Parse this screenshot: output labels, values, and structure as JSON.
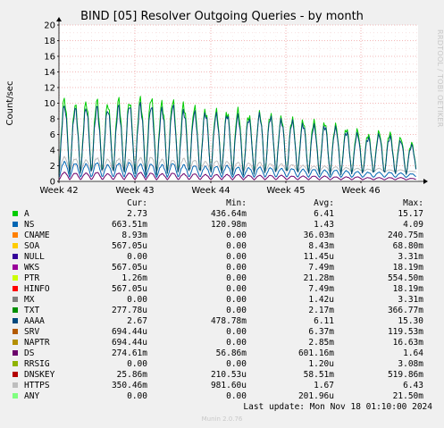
{
  "title": "BIND [05] Resolver Outgoing Queries - by month",
  "side_label": "RRDTOOL / TOBI OETIKER",
  "footer": {
    "last_update": "Last update: Mon Nov 18 01:10:00 2024",
    "generator": "Munin 2.0.76"
  },
  "legend_header": {
    "cur": "Cur:",
    "min": "Min:",
    "avg": "Avg:",
    "max": "Max:"
  },
  "legend": [
    {
      "name": "A",
      "color": "#00cc00",
      "cur": "2.73",
      "min": "436.64m",
      "avg": "6.41",
      "max": "15.17"
    },
    {
      "name": "NS",
      "color": "#0066b3",
      "cur": "663.51m",
      "min": "120.98m",
      "avg": "1.43",
      "max": "4.09"
    },
    {
      "name": "CNAME",
      "color": "#ff8000",
      "cur": "8.93m",
      "min": "0.00",
      "avg": "36.03m",
      "max": "240.75m"
    },
    {
      "name": "SOA",
      "color": "#ffcc00",
      "cur": "567.05u",
      "min": "0.00",
      "avg": "8.43m",
      "max": "68.80m"
    },
    {
      "name": "NULL",
      "color": "#330099",
      "cur": "0.00",
      "min": "0.00",
      "avg": "11.45u",
      "max": "3.31m"
    },
    {
      "name": "WKS",
      "color": "#990099",
      "cur": "567.05u",
      "min": "0.00",
      "avg": "7.49m",
      "max": "18.19m"
    },
    {
      "name": "PTR",
      "color": "#ccff00",
      "cur": "1.26m",
      "min": "0.00",
      "avg": "21.28m",
      "max": "554.50m"
    },
    {
      "name": "HINFO",
      "color": "#ff0000",
      "cur": "567.05u",
      "min": "0.00",
      "avg": "7.49m",
      "max": "18.19m"
    },
    {
      "name": "MX",
      "color": "#808080",
      "cur": "0.00",
      "min": "0.00",
      "avg": "1.42u",
      "max": "3.31m"
    },
    {
      "name": "TXT",
      "color": "#008f00",
      "cur": "277.78u",
      "min": "0.00",
      "avg": "2.17m",
      "max": "366.77m"
    },
    {
      "name": "AAAA",
      "color": "#00487d",
      "cur": "2.67",
      "min": "478.78m",
      "avg": "6.11",
      "max": "15.30"
    },
    {
      "name": "SRV",
      "color": "#b35a00",
      "cur": "694.44u",
      "min": "0.00",
      "avg": "6.37m",
      "max": "119.53m"
    },
    {
      "name": "NAPTR",
      "color": "#b38f00",
      "cur": "694.44u",
      "min": "0.00",
      "avg": "2.85m",
      "max": "16.63m"
    },
    {
      "name": "DS",
      "color": "#6b006b",
      "cur": "274.61m",
      "min": "56.86m",
      "avg": "601.16m",
      "max": "1.64"
    },
    {
      "name": "RRSIG",
      "color": "#8fb300",
      "cur": "0.00",
      "min": "0.00",
      "avg": "1.20u",
      "max": "3.08m"
    },
    {
      "name": "DNSKEY",
      "color": "#b30000",
      "cur": "25.86m",
      "min": "210.53u",
      "avg": "58.51m",
      "max": "519.86m"
    },
    {
      "name": "HTTPS",
      "color": "#bebebe",
      "cur": "350.46m",
      "min": "981.60u",
      "avg": "1.67",
      "max": "6.43"
    },
    {
      "name": "ANY",
      "color": "#80ff80",
      "cur": "0.00",
      "min": "0.00",
      "avg": "201.96u",
      "max": "21.50m"
    }
  ],
  "chart_data": {
    "type": "line",
    "title": "BIND [05] Resolver Outgoing Queries - by month",
    "ylabel": "Count/sec",
    "xlabel": "",
    "ylim": [
      0,
      20
    ],
    "yticks": [
      0,
      2,
      4,
      6,
      8,
      10,
      12,
      14,
      16,
      18,
      20
    ],
    "xticks": [
      "Week 42",
      "Week 43",
      "Week 44",
      "Week 45",
      "Week 46"
    ],
    "grid": true,
    "days": 33,
    "daily_peaks": {
      "A": [
        11.0,
        10.2,
        10.6,
        10.8,
        10.4,
        10.9,
        10.7,
        11.0,
        11.2,
        10.5,
        10.8,
        10.4,
        9.9,
        9.6,
        9.4,
        9.4,
        9.5,
        8.9,
        9.1,
        9.0,
        8.5,
        8.4,
        8.1,
        8.0,
        7.9,
        7.5,
        7.1,
        6.8,
        6.3,
        6.6,
        6.5,
        5.8,
        5.1
      ],
      "AAAA": [
        10.1,
        9.7,
        9.8,
        9.9,
        9.6,
        10.0,
        10.2,
        10.3,
        10.0,
        9.7,
        10.1,
        9.5,
        9.2,
        9.2,
        8.9,
        9.0,
        8.7,
        8.4,
        8.9,
        8.6,
        8.2,
        8.0,
        7.7,
        7.4,
        7.5,
        7.1,
        6.7,
        6.3,
        5.9,
        6.2,
        6.0,
        5.4,
        4.8
      ],
      "NS": [
        2.6,
        2.4,
        2.3,
        2.5,
        2.2,
        2.4,
        2.5,
        2.3,
        2.3,
        2.2,
        2.4,
        2.2,
        2.1,
        2.0,
        2.0,
        2.1,
        1.9,
        1.8,
        1.9,
        1.8,
        1.7,
        1.7,
        1.6,
        1.6,
        1.5,
        1.5,
        1.4,
        1.3,
        1.2,
        1.2,
        1.2,
        1.1,
        1.0
      ],
      "HTTPS": [
        3.2,
        3.0,
        2.8,
        3.1,
        2.9,
        3.0,
        2.9,
        3.1,
        3.2,
        2.9,
        2.8,
        3.0,
        2.8,
        2.6,
        2.7,
        2.6,
        2.5,
        2.4,
        2.5,
        2.3,
        2.3,
        2.2,
        2.1,
        2.0,
        2.0,
        1.9,
        1.8,
        1.7,
        1.6,
        1.7,
        1.5,
        1.5,
        1.3
      ],
      "DS": [
        1.2,
        1.1,
        1.1,
        1.2,
        1.0,
        1.1,
        1.1,
        1.2,
        1.1,
        1.0,
        1.1,
        1.0,
        1.0,
        0.9,
        0.9,
        0.9,
        0.9,
        0.8,
        0.8,
        0.8,
        0.8,
        0.7,
        0.7,
        0.7,
        0.7,
        0.6,
        0.6,
        0.6,
        0.5,
        0.5,
        0.5,
        0.5,
        0.4
      ]
    },
    "daily_troughs": {
      "A": 0.8,
      "AAAA": 0.8,
      "NS": 0.5,
      "HTTPS": 1.2,
      "DS": 0.2
    }
  }
}
